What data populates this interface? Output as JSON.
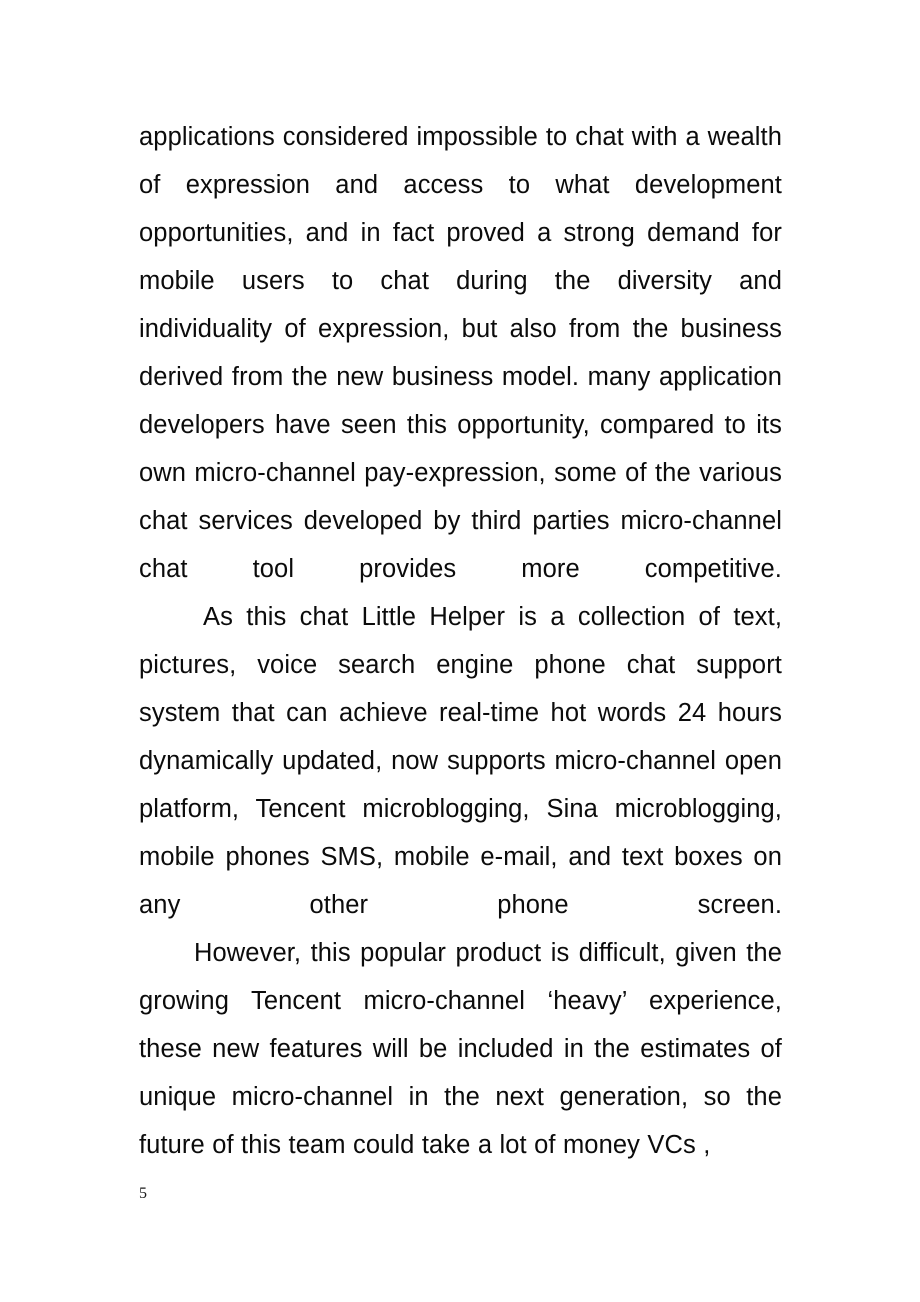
{
  "document": {
    "page_number": "5",
    "background_color": "#ffffff",
    "text_color": "#0b0b0b",
    "paragraphs": [
      {
        "id": "p1",
        "role": "continuation",
        "text": "applications considered impossible to chat with a wealth of expression and access to what development opportunities, and in fact proved a strong demand for mobile users to chat during the diversity and individuality of expression, but also from the business derived from the new business model. many application developers have seen this opportunity, compared to its own micro-channel pay-expression, some of the various chat services developed by third parties micro-channel chat tool provides more competitive."
      },
      {
        "id": "p2",
        "role": "body",
        "text": "As this chat Little Helper is a collection of text, pictures, voice search engine phone chat support system that can achieve real-time hot words 24 hours dynamically updated, now supports micro-channel open platform, Tencent microblogging, Sina microblogging, mobile phones SMS, mobile e-mail, and text boxes on any other phone screen."
      },
      {
        "id": "p3",
        "role": "body",
        "text": "However, this popular product is difficult, given the growing Tencent micro-channel  ‘heavy’  experience, these new features will be included in the estimates of unique micro-channel in the next generation, so the future of this team could take a lot of money VCs ,"
      }
    ]
  }
}
